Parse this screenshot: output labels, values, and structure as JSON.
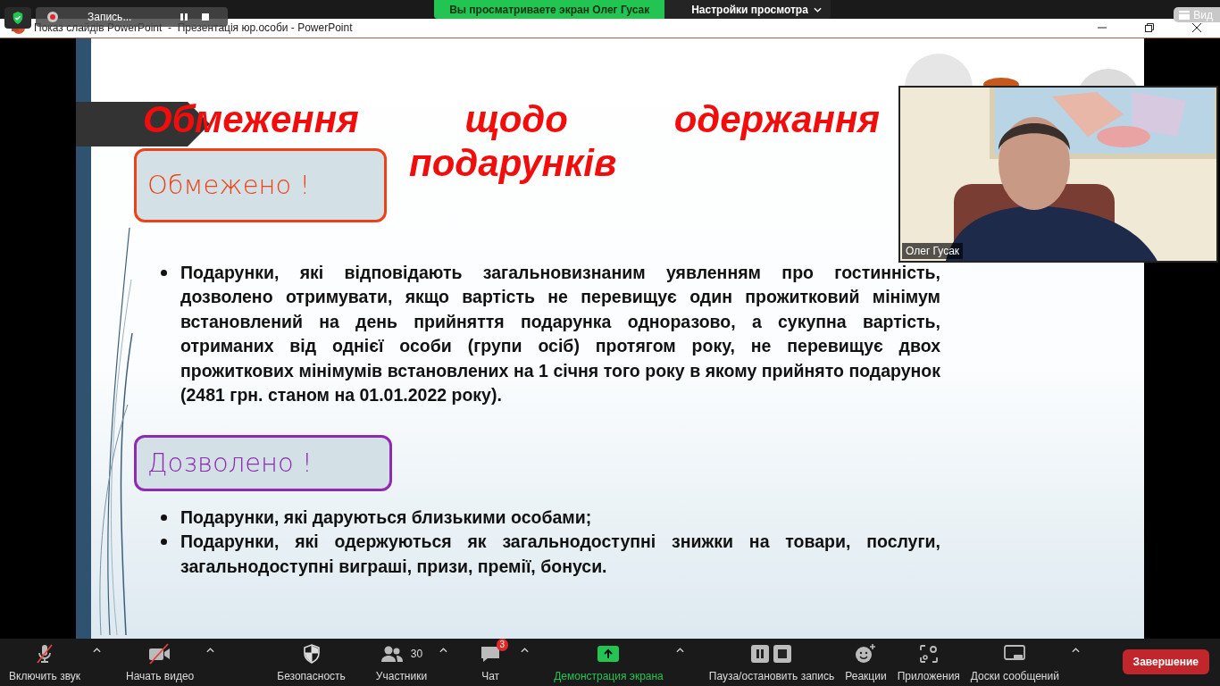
{
  "meeting_banner": {
    "viewing_text": "Вы просматриваете экран Олег Гусак",
    "view_options": "Настройки просмотра"
  },
  "recording": {
    "label": "Запись..."
  },
  "view_button": "Вид",
  "window": {
    "title": "Показ слайдів PowerPoint  -  Презентація юр.особи - PowerPoint"
  },
  "slide": {
    "title_lines": [
      "Обмеження щодо одержання",
      "подарунків"
    ],
    "sections": [
      {
        "heading": "Обмежено !",
        "color": "#ee4216",
        "bullets": [
          "Подарунки, які відповідають загальновизнаним уявленням про гостинність, дозволено отримувати, якщо вартість не перевищує один прожитковий мінімум встановлений на день прийняття подарунка одноразово, а сукупна вартість, отриманих від однієї особи (групи осіб) протягом року, не перевищує двох прожиткових мінімумів встановлених на 1 січня того року в якому прийнято подарунок (2481 грн. станом на 01.01.2022 року)."
        ]
      },
      {
        "heading": "Дозволено !",
        "color": "#8e2bb0",
        "bullets": [
          "Подарунки, які даруються близькими особами;",
          "Подарунки, які одержуються як загальнодоступні знижки на товари, послуги, загальнодоступні виграші, призи, премії, бонуси."
        ]
      }
    ]
  },
  "video": {
    "name": "Олег Гусак"
  },
  "toolbar": {
    "items": [
      {
        "kind": "mic",
        "label": "Включить звук",
        "muted": true,
        "caret": true
      },
      {
        "kind": "camera",
        "label": "Начать видео",
        "muted": true,
        "caret": true
      },
      {
        "kind": "security",
        "label": "Безопасность",
        "caret": false
      },
      {
        "kind": "participants",
        "label": "Участники",
        "count": "30",
        "caret": true
      },
      {
        "kind": "chat",
        "label": "Чат",
        "badge": "3",
        "caret": true
      },
      {
        "kind": "share",
        "label": "Демонстрация экрана",
        "active": true,
        "caret": true
      },
      {
        "kind": "record",
        "label": "Пауза/остановить запись",
        "caret": false
      },
      {
        "kind": "reactions",
        "label": "Реакции",
        "caret": false
      },
      {
        "kind": "apps",
        "label": "Приложения",
        "caret": false
      },
      {
        "kind": "whiteboard",
        "label": "Доски сообщений",
        "caret": true
      }
    ],
    "end_button": "Завершение"
  }
}
